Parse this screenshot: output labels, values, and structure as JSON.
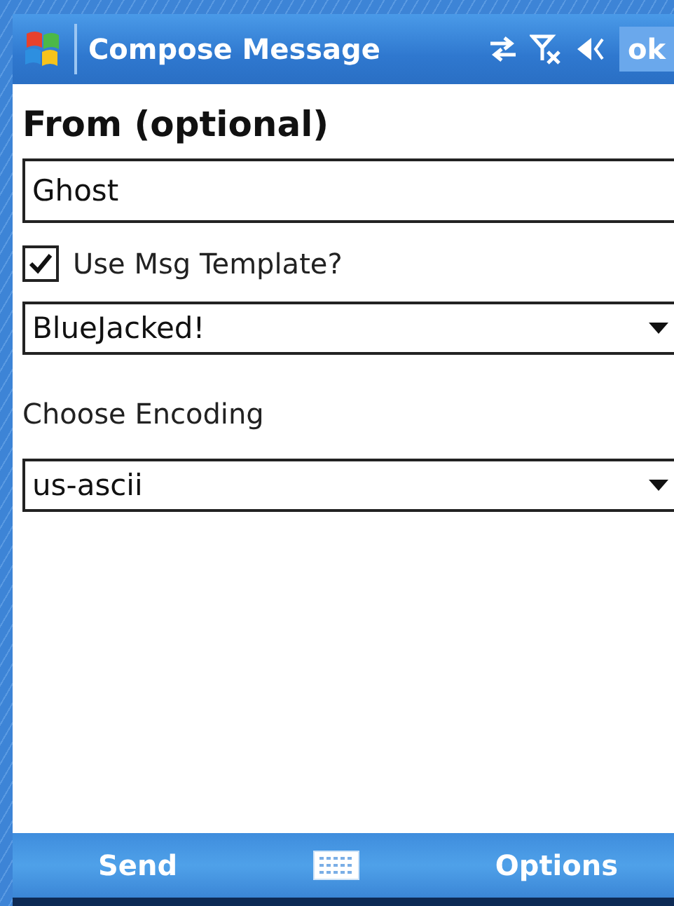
{
  "title_bar": {
    "title": "Compose Message",
    "ok": "ok"
  },
  "from": {
    "label": "From (optional)",
    "value": "Ghost"
  },
  "template": {
    "label": "Use Msg Template?",
    "checked": true,
    "value": "BlueJacked!"
  },
  "encoding": {
    "label": "Choose Encoding",
    "value": "us-ascii"
  },
  "soft_keys": {
    "left": "Send",
    "right": "Options"
  }
}
